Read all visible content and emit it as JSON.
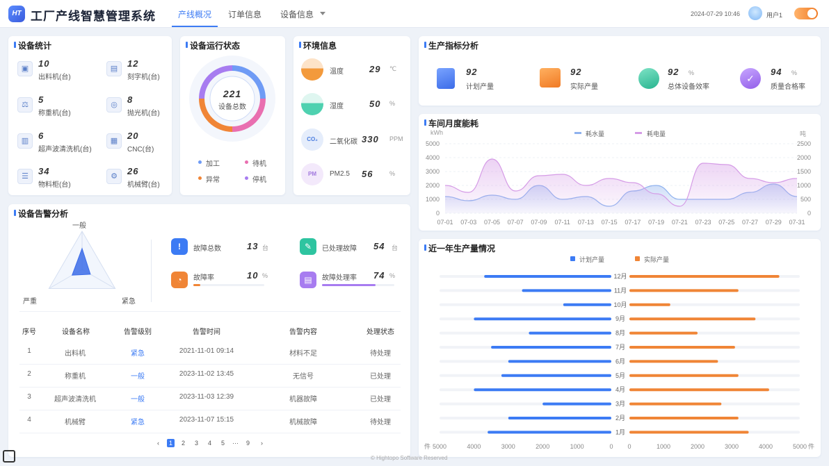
{
  "app": {
    "logo": "HT",
    "title": "工厂产线智慧管理系统",
    "nav": [
      "产线概况",
      "订单信息",
      "设备信息"
    ],
    "datetime": "2024-07-29 10:46",
    "user": "用户1"
  },
  "device_stats": {
    "title": "设备统计",
    "items": [
      {
        "value": "10",
        "label": "出料机(台)",
        "icon": "discharger-icon"
      },
      {
        "value": "12",
        "label": "刻字机(台)",
        "icon": "engraver-icon"
      },
      {
        "value": "5",
        "label": "称重机(台)",
        "icon": "scale-icon"
      },
      {
        "value": "8",
        "label": "抛光机(台)",
        "icon": "polisher-icon"
      },
      {
        "value": "6",
        "label": "超声波清洗机(台)",
        "icon": "cleaner-icon"
      },
      {
        "value": "20",
        "label": "CNC(台)",
        "icon": "cnc-icon"
      },
      {
        "value": "34",
        "label": "物料柜(台)",
        "icon": "cabinet-icon"
      },
      {
        "value": "26",
        "label": "机械臂(台)",
        "icon": "robot-arm-icon"
      }
    ]
  },
  "device_status": {
    "title": "设备运行状态",
    "total": "221",
    "total_label": "设备总数",
    "legend": [
      {
        "label": "加工",
        "color": "#6f9bf5"
      },
      {
        "label": "待机",
        "color": "#e96fb0"
      },
      {
        "label": "异常",
        "color": "#f08536"
      },
      {
        "label": "停机",
        "color": "#a77cf0"
      }
    ]
  },
  "environment": {
    "title": "环境信息",
    "items": [
      {
        "label": "温度",
        "value": "29",
        "unit": "℃",
        "icon": "thermometer-icon"
      },
      {
        "label": "湿度",
        "value": "50",
        "unit": "%",
        "icon": "humidity-icon"
      },
      {
        "label": "二氧化碳",
        "value": "330",
        "unit": "PPM",
        "icon": "co2-cloud-icon"
      },
      {
        "label": "PM2.5",
        "value": "56",
        "unit": "%",
        "icon": "pm-icon"
      }
    ]
  },
  "production": {
    "title": "生产指标分析",
    "items": [
      {
        "value": "92",
        "unit": "",
        "label": "计划产量",
        "color": "#3c7bf4",
        "icon": "document-icon"
      },
      {
        "value": "92",
        "unit": "",
        "label": "实际产量",
        "color": "#f08536",
        "icon": "bar-chart-icon"
      },
      {
        "value": "92",
        "unit": "%",
        "label": "总体设备效率",
        "color": "#2ec4a0",
        "icon": "rocket-icon"
      },
      {
        "value": "94",
        "unit": "%",
        "label": "质量合格率",
        "color": "#a77cf0",
        "icon": "check-circle-icon"
      }
    ]
  },
  "alarm": {
    "title": "设备告警分析",
    "radar_labels": [
      "一般",
      "严重",
      "紧急"
    ],
    "radar_values": [
      0.55,
      0.3,
      0.25
    ],
    "stats": [
      {
        "label": "故障总数",
        "value": "13",
        "unit": "台",
        "color": "#3c7bf4",
        "icon": "warning-icon"
      },
      {
        "label": "已处理故障",
        "value": "54",
        "unit": "台",
        "color": "#2ec4a0",
        "icon": "wrench-icon"
      },
      {
        "label": "故障率",
        "value": "10",
        "unit": "%",
        "color": "#f08536",
        "icon": "pie-icon",
        "progress": 0.1
      },
      {
        "label": "故障处理率",
        "value": "74",
        "unit": "%",
        "color": "#a77cf0",
        "icon": "calendar-icon",
        "progress": 0.74
      }
    ],
    "table": {
      "headers": [
        "序号",
        "设备名称",
        "告警级别",
        "告警时间",
        "告警内容",
        "处理状态"
      ],
      "rows": [
        [
          "1",
          "出料机",
          "紧急",
          "2021-11-01 09:14",
          "材料不足",
          "待处理"
        ],
        [
          "2",
          "称重机",
          "一般",
          "2023-11-02 13:45",
          "无信号",
          "已处理"
        ],
        [
          "3",
          "超声波清洗机",
          "一般",
          "2023-11-03 12:39",
          "机器故障",
          "已处理"
        ],
        [
          "4",
          "机械臂",
          "紧急",
          "2023-11-07 15:15",
          "机械故障",
          "待处理"
        ]
      ]
    },
    "pagination": [
      "‹",
      "1",
      "2",
      "3",
      "4",
      "5",
      "···",
      "9",
      "›"
    ]
  },
  "energy": {
    "title": "车间月度能耗",
    "legend": [
      "耗水量",
      "耗电量"
    ],
    "left_unit": "kWh",
    "right_unit": "吨",
    "chart_data": {
      "type": "area",
      "x": [
        "07-01",
        "07-03",
        "07-05",
        "07-07",
        "07-09",
        "07-11",
        "07-13",
        "07-15",
        "07-17",
        "07-19",
        "07-21",
        "07-23",
        "07-25",
        "07-27",
        "07-29",
        "07-31"
      ],
      "y_ticks_left": [
        0,
        1000,
        2000,
        3000,
        4000,
        5000
      ],
      "y_ticks_right": [
        0,
        500,
        1000,
        1500,
        2000,
        2500
      ],
      "ylim_left": [
        0,
        5000
      ],
      "ylim_right": [
        0,
        2500
      ],
      "series": [
        {
          "name": "耗水量",
          "axis": "left",
          "color": "#8fb2ee",
          "values": [
            1200,
            900,
            1300,
            1000,
            2000,
            1000,
            1200,
            500,
            1600,
            2000,
            1000,
            1000,
            1000,
            1500,
            2100,
            1200
          ]
        },
        {
          "name": "耗电量",
          "axis": "right",
          "color": "#d59be6",
          "values": [
            1000,
            750,
            1950,
            800,
            1350,
            1400,
            1000,
            1250,
            1100,
            700,
            250,
            1800,
            1750,
            1250,
            1100,
            1250
          ]
        }
      ]
    }
  },
  "yearly": {
    "title": "近一年生产量情况",
    "legend": [
      "计划产量",
      "实际产量"
    ],
    "unit": "件",
    "chart_data": {
      "type": "bar",
      "categories": [
        "12月",
        "11月",
        "10月",
        "9月",
        "8月",
        "7月",
        "6月",
        "5月",
        "4月",
        "3月",
        "2月",
        "1月"
      ],
      "series": [
        {
          "name": "计划产量",
          "color": "#3c7bf4",
          "values": [
            3700,
            2600,
            1400,
            4000,
            2400,
            3500,
            3000,
            3200,
            4000,
            2000,
            3000,
            3600
          ]
        },
        {
          "name": "实际产量",
          "color": "#f08536",
          "values": [
            4400,
            3200,
            1200,
            3700,
            2000,
            3100,
            2600,
            3200,
            4100,
            2700,
            3200,
            3500
          ]
        }
      ],
      "ticks_left": [
        "5000",
        "4000",
        "3000",
        "2000",
        "1000",
        "0"
      ],
      "ticks_right": [
        "0",
        "1000",
        "2000",
        "3000",
        "4000",
        "5000"
      ],
      "xlim": [
        0,
        5000
      ]
    }
  },
  "footer": "© Hightopo Software Reserved"
}
